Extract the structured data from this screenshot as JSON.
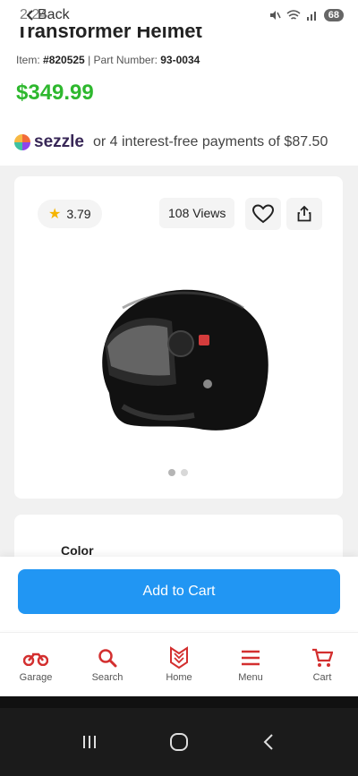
{
  "status_bar": {
    "time": "2:24",
    "back_label": "Back",
    "battery": "68"
  },
  "product": {
    "title_fragment": "Transformer Helmet",
    "item_label": "Item:",
    "item_number": "#820525",
    "separator": "|",
    "part_label": "Part Number:",
    "part_number": "93-0034",
    "price": "$349.99"
  },
  "sezzle": {
    "logo_text": "sezzle",
    "text": "or 4 interest-free payments of $87.50"
  },
  "gallery": {
    "rating": "3.79",
    "views": "108 Views",
    "dots_count": 2,
    "active_dot": 0
  },
  "options": {
    "color_label": "Color"
  },
  "cart": {
    "add_label": "Add to Cart"
  },
  "bottom_nav": {
    "items": [
      {
        "label": "Garage",
        "icon": "motorcycle-icon"
      },
      {
        "label": "Search",
        "icon": "search-icon"
      },
      {
        "label": "Home",
        "icon": "home-logo-icon"
      },
      {
        "label": "Menu",
        "icon": "hamburger-menu-icon"
      },
      {
        "label": "Cart",
        "icon": "cart-icon"
      }
    ]
  },
  "colors": {
    "price_green": "#2eb82e",
    "primary_blue": "#2196f3",
    "nav_red": "#d32f2f"
  }
}
